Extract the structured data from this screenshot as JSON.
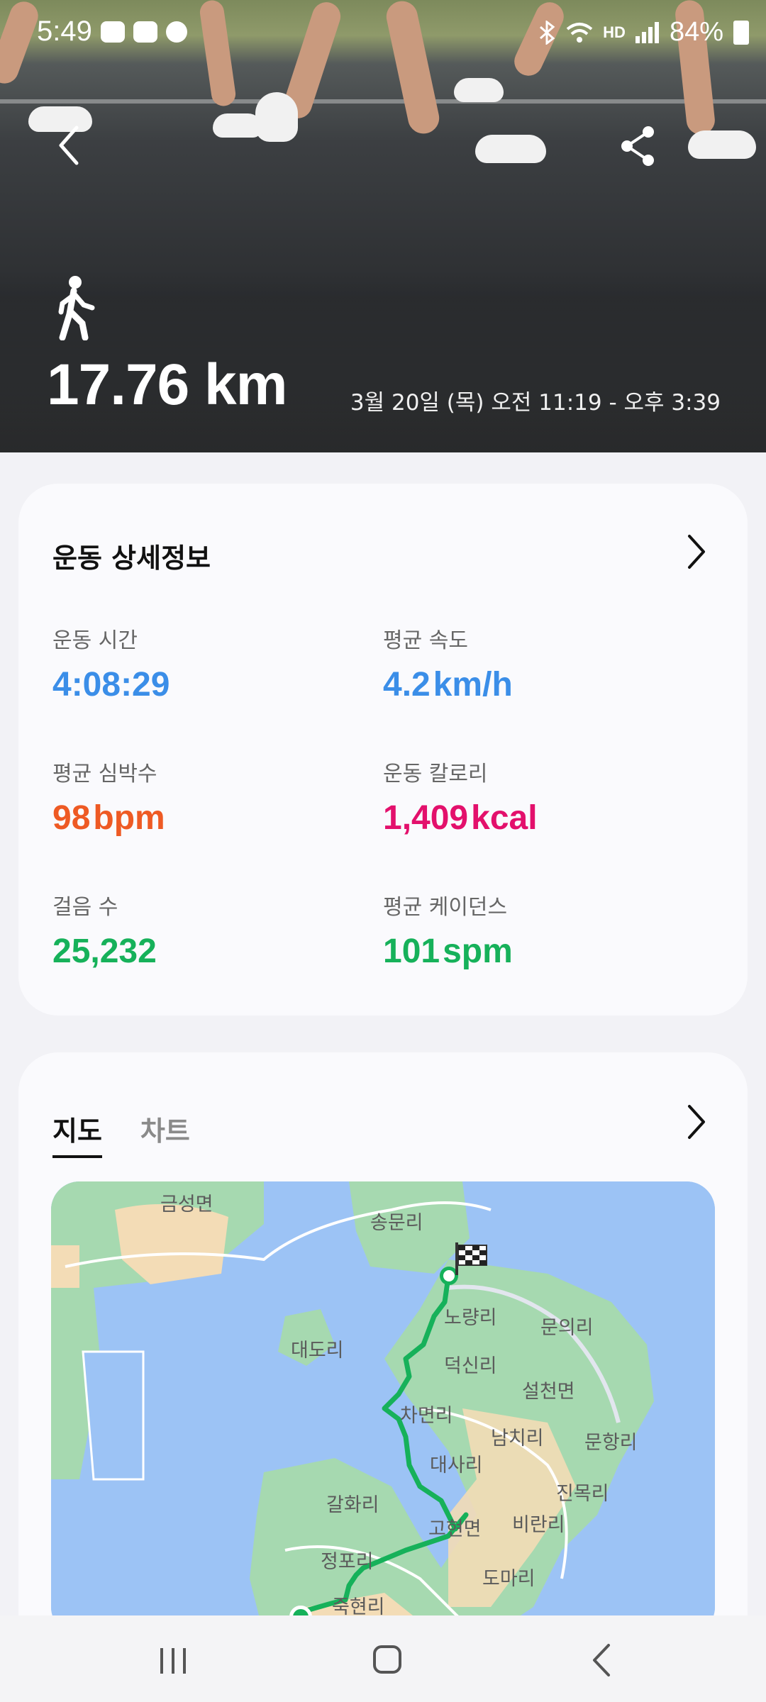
{
  "status_bar": {
    "time": "5:49",
    "battery": "84%",
    "network": "HD"
  },
  "hero": {
    "distance": "17.76 km",
    "datetime": "3월 20일 (목) 오전 11:19 - 오후 3:39",
    "activity_icon": "walking-person-icon"
  },
  "details": {
    "title": "운동 상세정보",
    "stats": [
      {
        "label": "운동 시간",
        "value": "4:08:29",
        "unit": "",
        "color": "#3b8ee8"
      },
      {
        "label": "평균 속도",
        "value": "4.2",
        "unit": "km/h",
        "color": "#3b8ee8"
      },
      {
        "label": "평균 심박수",
        "value": "98",
        "unit": "bpm",
        "color": "#ee5a24"
      },
      {
        "label": "운동 칼로리",
        "value": "1,409",
        "unit": "kcal",
        "color": "#e3106c"
      },
      {
        "label": "걸음 수",
        "value": "25,232",
        "unit": "",
        "color": "#16b15a"
      },
      {
        "label": "평균 케이던스",
        "value": "101",
        "unit": "spm",
        "color": "#16b15a"
      }
    ]
  },
  "map_section": {
    "tabs": [
      "지도",
      "차트"
    ],
    "active_tab": "지도",
    "route_color": "#16b15a",
    "labels": {
      "l1": "금성면",
      "l2": "송문리",
      "l3": "노량리",
      "l4": "문의리",
      "l5": "대도리",
      "l6": "덕신리",
      "l7": "설천면",
      "l8": "차면리",
      "l9": "남치리",
      "l10": "문항리",
      "l11": "대사리",
      "l12": "진목리",
      "l13": "갈화리",
      "l14": "고현면",
      "l15": "비란리",
      "l16": "정포리",
      "l17": "도마리",
      "l18": "죽현리"
    }
  }
}
